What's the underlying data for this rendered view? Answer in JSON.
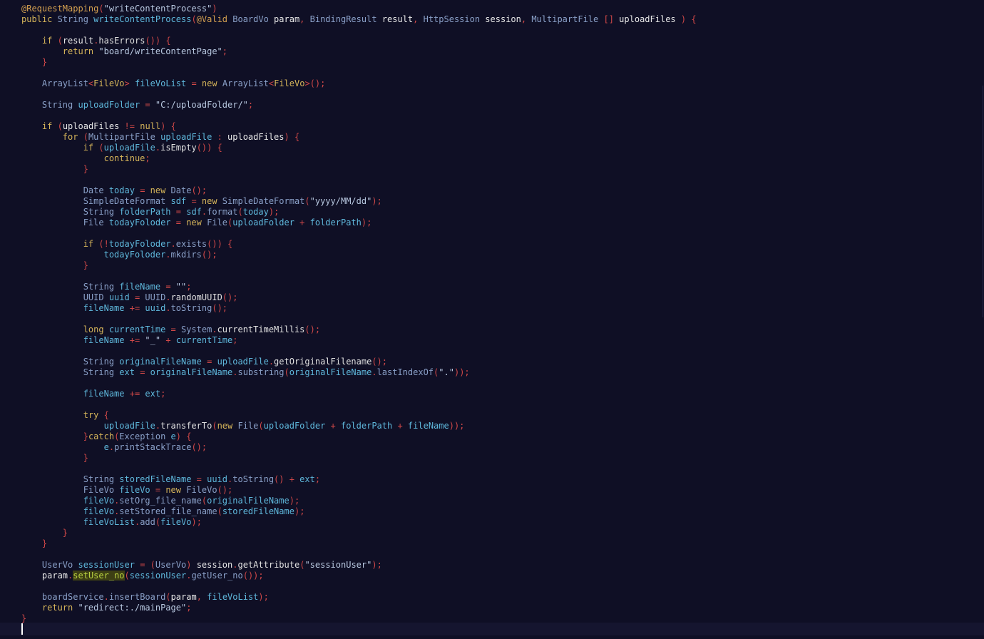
{
  "colors": {
    "background": "#0f0f25",
    "current_line": "#15152f",
    "plain": "#e8e8e8",
    "keyword": "#d6b55a",
    "type": "#8aa0c8",
    "variable": "#5fb8dc",
    "string": "#b8c8e0",
    "punct": "#d04848",
    "annotation": "#d4a050",
    "function": "#e0e0e0",
    "highlight_bg": "#3d3f14",
    "highlight_fg": "#b8d040",
    "cursor": "#ffffff"
  },
  "editor": {
    "lines": [
      [
        [
          "annotation",
          "@RequestMapping"
        ],
        [
          "punct",
          "("
        ],
        [
          "string",
          "\"writeContentProcess\""
        ],
        [
          "punct",
          ")"
        ]
      ],
      [
        [
          "keyword",
          "public "
        ],
        [
          "type",
          "String "
        ],
        [
          "variable",
          "writeContentProcess"
        ],
        [
          "punct",
          "("
        ],
        [
          "annotation",
          "@Valid "
        ],
        [
          "type",
          "BoardVo "
        ],
        [
          "plain",
          "param"
        ],
        [
          "punct",
          ", "
        ],
        [
          "type",
          "BindingResult "
        ],
        [
          "plain",
          "result"
        ],
        [
          "punct",
          ", "
        ],
        [
          "type",
          "HttpSession "
        ],
        [
          "plain",
          "session"
        ],
        [
          "punct",
          ", "
        ],
        [
          "type",
          "MultipartFile "
        ],
        [
          "punct",
          "[] "
        ],
        [
          "plain",
          "uploadFiles "
        ],
        [
          "punct",
          ") {"
        ]
      ],
      [],
      [
        [
          "plain",
          "    "
        ],
        [
          "keyword",
          "if "
        ],
        [
          "punct",
          "("
        ],
        [
          "plain",
          "result"
        ],
        [
          "punct",
          "."
        ],
        [
          "function",
          "hasErrors"
        ],
        [
          "punct",
          "()) {"
        ]
      ],
      [
        [
          "plain",
          "        "
        ],
        [
          "keyword",
          "return "
        ],
        [
          "string",
          "\"board/writeContentPage\""
        ],
        [
          "punct",
          ";"
        ]
      ],
      [
        [
          "plain",
          "    "
        ],
        [
          "punct",
          "}"
        ]
      ],
      [],
      [
        [
          "plain",
          "    "
        ],
        [
          "type",
          "ArrayList"
        ],
        [
          "punct",
          "<"
        ],
        [
          "keyword",
          "FileVo"
        ],
        [
          "punct",
          "> "
        ],
        [
          "variable",
          "fileVoList "
        ],
        [
          "punct",
          "= "
        ],
        [
          "keyword",
          "new "
        ],
        [
          "type",
          "ArrayList"
        ],
        [
          "punct",
          "<"
        ],
        [
          "keyword",
          "FileVo"
        ],
        [
          "punct",
          ">();"
        ]
      ],
      [],
      [
        [
          "plain",
          "    "
        ],
        [
          "type",
          "String "
        ],
        [
          "variable",
          "uploadFolder "
        ],
        [
          "punct",
          "= "
        ],
        [
          "string",
          "\"C:/uploadFolder/\""
        ],
        [
          "punct",
          ";"
        ]
      ],
      [],
      [
        [
          "plain",
          "    "
        ],
        [
          "keyword",
          "if "
        ],
        [
          "punct",
          "("
        ],
        [
          "plain",
          "uploadFiles "
        ],
        [
          "punct",
          "!= "
        ],
        [
          "keyword",
          "null"
        ],
        [
          "punct",
          ") {"
        ]
      ],
      [
        [
          "plain",
          "        "
        ],
        [
          "keyword",
          "for "
        ],
        [
          "punct",
          "("
        ],
        [
          "type",
          "MultipartFile "
        ],
        [
          "variable",
          "uploadFile "
        ],
        [
          "punct",
          ": "
        ],
        [
          "plain",
          "uploadFiles"
        ],
        [
          "punct",
          ") {"
        ]
      ],
      [
        [
          "plain",
          "            "
        ],
        [
          "keyword",
          "if "
        ],
        [
          "punct",
          "("
        ],
        [
          "variable",
          "uploadFile"
        ],
        [
          "punct",
          "."
        ],
        [
          "function",
          "isEmpty"
        ],
        [
          "punct",
          "()) {"
        ]
      ],
      [
        [
          "plain",
          "                "
        ],
        [
          "keyword",
          "continue"
        ],
        [
          "punct",
          ";"
        ]
      ],
      [
        [
          "plain",
          "            "
        ],
        [
          "punct",
          "}"
        ]
      ],
      [],
      [
        [
          "plain",
          "            "
        ],
        [
          "type",
          "Date "
        ],
        [
          "variable",
          "today "
        ],
        [
          "punct",
          "= "
        ],
        [
          "keyword",
          "new "
        ],
        [
          "type",
          "Date"
        ],
        [
          "punct",
          "();"
        ]
      ],
      [
        [
          "plain",
          "            "
        ],
        [
          "type",
          "SimpleDateFormat "
        ],
        [
          "variable",
          "sdf "
        ],
        [
          "punct",
          "= "
        ],
        [
          "keyword",
          "new "
        ],
        [
          "type",
          "SimpleDateFormat"
        ],
        [
          "punct",
          "("
        ],
        [
          "string",
          "\"yyyy/MM/dd\""
        ],
        [
          "punct",
          ");"
        ]
      ],
      [
        [
          "plain",
          "            "
        ],
        [
          "type",
          "String "
        ],
        [
          "variable",
          "folderPath "
        ],
        [
          "punct",
          "= "
        ],
        [
          "variable",
          "sdf"
        ],
        [
          "punct",
          "."
        ],
        [
          "type",
          "format"
        ],
        [
          "punct",
          "("
        ],
        [
          "variable",
          "today"
        ],
        [
          "punct",
          ");"
        ]
      ],
      [
        [
          "plain",
          "            "
        ],
        [
          "type",
          "File "
        ],
        [
          "variable",
          "todayFoloder "
        ],
        [
          "punct",
          "= "
        ],
        [
          "keyword",
          "new "
        ],
        [
          "type",
          "File"
        ],
        [
          "punct",
          "("
        ],
        [
          "variable",
          "uploadFolder "
        ],
        [
          "punct",
          "+ "
        ],
        [
          "variable",
          "folderPath"
        ],
        [
          "punct",
          ");"
        ]
      ],
      [],
      [
        [
          "plain",
          "            "
        ],
        [
          "keyword",
          "if "
        ],
        [
          "punct",
          "(!"
        ],
        [
          "variable",
          "todayFoloder"
        ],
        [
          "punct",
          "."
        ],
        [
          "type",
          "exists"
        ],
        [
          "punct",
          "()) {"
        ]
      ],
      [
        [
          "plain",
          "                "
        ],
        [
          "variable",
          "todayFoloder"
        ],
        [
          "punct",
          "."
        ],
        [
          "type",
          "mkdirs"
        ],
        [
          "punct",
          "();"
        ]
      ],
      [
        [
          "plain",
          "            "
        ],
        [
          "punct",
          "}"
        ]
      ],
      [],
      [
        [
          "plain",
          "            "
        ],
        [
          "type",
          "String "
        ],
        [
          "variable",
          "fileName "
        ],
        [
          "punct",
          "= "
        ],
        [
          "string",
          "\"\""
        ],
        [
          "punct",
          ";"
        ]
      ],
      [
        [
          "plain",
          "            "
        ],
        [
          "type",
          "UUID "
        ],
        [
          "variable",
          "uuid "
        ],
        [
          "punct",
          "= "
        ],
        [
          "type",
          "UUID"
        ],
        [
          "punct",
          "."
        ],
        [
          "function",
          "randomUUID"
        ],
        [
          "punct",
          "();"
        ]
      ],
      [
        [
          "plain",
          "            "
        ],
        [
          "variable",
          "fileName "
        ],
        [
          "punct",
          "+= "
        ],
        [
          "variable",
          "uuid"
        ],
        [
          "punct",
          "."
        ],
        [
          "type",
          "toString"
        ],
        [
          "punct",
          "();"
        ]
      ],
      [],
      [
        [
          "plain",
          "            "
        ],
        [
          "keyword",
          "long "
        ],
        [
          "variable",
          "currentTime "
        ],
        [
          "punct",
          "= "
        ],
        [
          "type",
          "System"
        ],
        [
          "punct",
          "."
        ],
        [
          "function",
          "currentTimeMillis"
        ],
        [
          "punct",
          "();"
        ]
      ],
      [
        [
          "plain",
          "            "
        ],
        [
          "variable",
          "fileName "
        ],
        [
          "punct",
          "+= "
        ],
        [
          "string",
          "\"_\" "
        ],
        [
          "punct",
          "+ "
        ],
        [
          "variable",
          "currentTime"
        ],
        [
          "punct",
          ";"
        ]
      ],
      [],
      [
        [
          "plain",
          "            "
        ],
        [
          "type",
          "String "
        ],
        [
          "variable",
          "originalFileName "
        ],
        [
          "punct",
          "= "
        ],
        [
          "variable",
          "uploadFile"
        ],
        [
          "punct",
          "."
        ],
        [
          "function",
          "getOriginalFilename"
        ],
        [
          "punct",
          "();"
        ]
      ],
      [
        [
          "plain",
          "            "
        ],
        [
          "type",
          "String "
        ],
        [
          "variable",
          "ext "
        ],
        [
          "punct",
          "= "
        ],
        [
          "variable",
          "originalFileName"
        ],
        [
          "punct",
          "."
        ],
        [
          "type",
          "substring"
        ],
        [
          "punct",
          "("
        ],
        [
          "variable",
          "originalFileName"
        ],
        [
          "punct",
          "."
        ],
        [
          "type",
          "lastIndexOf"
        ],
        [
          "punct",
          "("
        ],
        [
          "string",
          "\".\""
        ],
        [
          "punct",
          "));"
        ]
      ],
      [],
      [
        [
          "plain",
          "            "
        ],
        [
          "variable",
          "fileName "
        ],
        [
          "punct",
          "+= "
        ],
        [
          "variable",
          "ext"
        ],
        [
          "punct",
          ";"
        ]
      ],
      [],
      [
        [
          "plain",
          "            "
        ],
        [
          "keyword",
          "try "
        ],
        [
          "punct",
          "{"
        ]
      ],
      [
        [
          "plain",
          "                "
        ],
        [
          "variable",
          "uploadFile"
        ],
        [
          "punct",
          "."
        ],
        [
          "function",
          "transferTo"
        ],
        [
          "punct",
          "("
        ],
        [
          "keyword",
          "new "
        ],
        [
          "type",
          "File"
        ],
        [
          "punct",
          "("
        ],
        [
          "variable",
          "uploadFolder "
        ],
        [
          "punct",
          "+ "
        ],
        [
          "variable",
          "folderPath "
        ],
        [
          "punct",
          "+ "
        ],
        [
          "variable",
          "fileName"
        ],
        [
          "punct",
          "));"
        ]
      ],
      [
        [
          "plain",
          "            "
        ],
        [
          "punct",
          "}"
        ],
        [
          "keyword",
          "catch"
        ],
        [
          "punct",
          "("
        ],
        [
          "type",
          "Exception "
        ],
        [
          "variable",
          "e"
        ],
        [
          "punct",
          ") {"
        ]
      ],
      [
        [
          "plain",
          "                "
        ],
        [
          "variable",
          "e"
        ],
        [
          "punct",
          "."
        ],
        [
          "type",
          "printStackTrace"
        ],
        [
          "punct",
          "();"
        ]
      ],
      [
        [
          "plain",
          "            "
        ],
        [
          "punct",
          "}"
        ]
      ],
      [],
      [
        [
          "plain",
          "            "
        ],
        [
          "type",
          "String "
        ],
        [
          "variable",
          "storedFileName "
        ],
        [
          "punct",
          "= "
        ],
        [
          "variable",
          "uuid"
        ],
        [
          "punct",
          "."
        ],
        [
          "type",
          "toString"
        ],
        [
          "punct",
          "() + "
        ],
        [
          "variable",
          "ext"
        ],
        [
          "punct",
          ";"
        ]
      ],
      [
        [
          "plain",
          "            "
        ],
        [
          "type",
          "FileVo "
        ],
        [
          "variable",
          "fileVo "
        ],
        [
          "punct",
          "= "
        ],
        [
          "keyword",
          "new "
        ],
        [
          "type",
          "FileVo"
        ],
        [
          "punct",
          "();"
        ]
      ],
      [
        [
          "plain",
          "            "
        ],
        [
          "variable",
          "fileVo"
        ],
        [
          "punct",
          "."
        ],
        [
          "type",
          "setOrg_file_name"
        ],
        [
          "punct",
          "("
        ],
        [
          "variable",
          "originalFileName"
        ],
        [
          "punct",
          ");"
        ]
      ],
      [
        [
          "plain",
          "            "
        ],
        [
          "variable",
          "fileVo"
        ],
        [
          "punct",
          "."
        ],
        [
          "type",
          "setStored_file_name"
        ],
        [
          "punct",
          "("
        ],
        [
          "variable",
          "storedFileName"
        ],
        [
          "punct",
          ");"
        ]
      ],
      [
        [
          "plain",
          "            "
        ],
        [
          "variable",
          "fileVoList"
        ],
        [
          "punct",
          "."
        ],
        [
          "type",
          "add"
        ],
        [
          "punct",
          "("
        ],
        [
          "variable",
          "fileVo"
        ],
        [
          "punct",
          ");"
        ]
      ],
      [
        [
          "plain",
          "        "
        ],
        [
          "punct",
          "}"
        ]
      ],
      [
        [
          "plain",
          "    "
        ],
        [
          "punct",
          "}"
        ]
      ],
      [],
      [
        [
          "plain",
          "    "
        ],
        [
          "type",
          "UserVo "
        ],
        [
          "variable",
          "sessionUser "
        ],
        [
          "punct",
          "= ("
        ],
        [
          "type",
          "UserVo"
        ],
        [
          "punct",
          ") "
        ],
        [
          "plain",
          "session"
        ],
        [
          "punct",
          "."
        ],
        [
          "function",
          "getAttribute"
        ],
        [
          "punct",
          "("
        ],
        [
          "string",
          "\"sessionUser\""
        ],
        [
          "punct",
          ");"
        ]
      ],
      [
        [
          "plain",
          "    "
        ],
        [
          "plain",
          "param"
        ],
        [
          "punct",
          "."
        ],
        [
          "highlight",
          "setUser_no"
        ],
        [
          "punct",
          "("
        ],
        [
          "variable",
          "sessionUser"
        ],
        [
          "punct",
          "."
        ],
        [
          "type",
          "getUser_no"
        ],
        [
          "punct",
          "());"
        ]
      ],
      [],
      [
        [
          "plain",
          "    "
        ],
        [
          "type",
          "boardService"
        ],
        [
          "punct",
          "."
        ],
        [
          "type",
          "insertBoard"
        ],
        [
          "punct",
          "("
        ],
        [
          "plain",
          "param"
        ],
        [
          "punct",
          ", "
        ],
        [
          "variable",
          "fileVoList"
        ],
        [
          "punct",
          ");"
        ]
      ],
      [
        [
          "plain",
          "    "
        ],
        [
          "keyword",
          "return "
        ],
        [
          "string",
          "\"redirect:./mainPage\""
        ],
        [
          "punct",
          ";"
        ]
      ],
      [
        [
          "punct",
          "}"
        ]
      ]
    ]
  }
}
